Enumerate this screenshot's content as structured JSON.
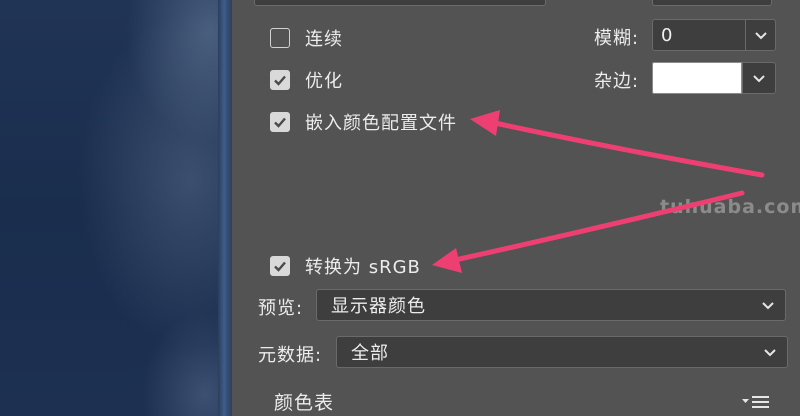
{
  "options": {
    "continuous": {
      "label": "连续",
      "checked": false
    },
    "optimize": {
      "label": "优化",
      "checked": true
    },
    "embed_profile": {
      "label": "嵌入颜色配置文件",
      "checked": true
    },
    "convert_srgb": {
      "label": "转换为 sRGB",
      "checked": true
    }
  },
  "blur": {
    "label": "模糊:",
    "value": "0"
  },
  "matte": {
    "label": "杂边:",
    "color": "#ffffff"
  },
  "preview": {
    "label": "预览:",
    "value": "显示器颜色"
  },
  "metadata": {
    "label": "元数据:",
    "value": "全部"
  },
  "color_table": {
    "label": "颜色表"
  },
  "watermark": "tuhuaba.com",
  "colors": {
    "panel": "#535353",
    "annotation_arrow": "#ee3f73"
  }
}
